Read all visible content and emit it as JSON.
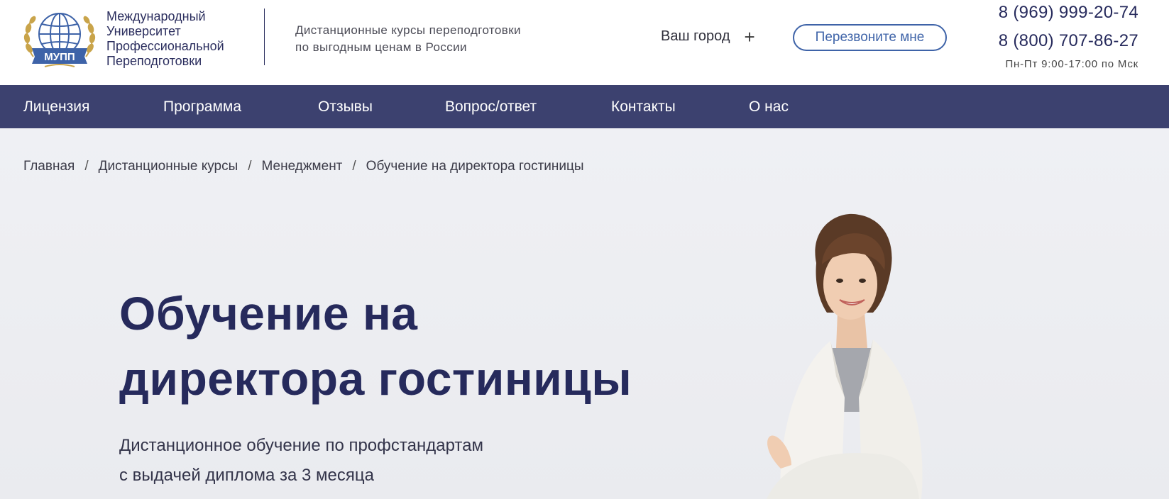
{
  "header": {
    "logo": {
      "emblem_text": "МУПП",
      "lines": [
        "Международный",
        "Университет",
        "Профессиональной",
        "Переподготовки"
      ]
    },
    "tagline": [
      "Дистанционные курсы переподготовки",
      "по выгодным ценам в России"
    ],
    "city_label": "Ваш город",
    "city_icon": "plus-icon",
    "callback_label": "Перезвоните мне",
    "phones": [
      "8 (969) 999-20-74",
      "8 (800) 707-86-27"
    ],
    "hours": "Пн-Пт 9:00-17:00 по Мск"
  },
  "nav": {
    "items": [
      "Лицензия",
      "Программа",
      "Отзывы",
      "Вопрос/ответ",
      "Контакты",
      "О нас"
    ]
  },
  "breadcrumb": {
    "items": [
      "Главная",
      "Дистанционные курсы",
      "Менеджмент",
      "Обучение на директора гостиницы"
    ],
    "separator": "/"
  },
  "hero": {
    "title": [
      "Обучение на",
      "директора гостиницы"
    ],
    "subtitle": [
      "Дистанционное обучение по профстандартам",
      "с выдачей диплома за 3 месяца"
    ]
  },
  "colors": {
    "brand_dark": "#262a5c",
    "nav_bg": "#3c416f",
    "accent_blue": "#3e63a8",
    "logo_gold": "#c9a44a",
    "hero_bg": "#eeeff3"
  }
}
